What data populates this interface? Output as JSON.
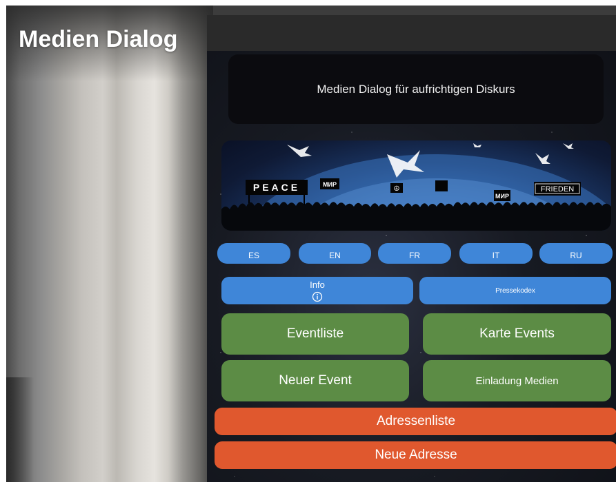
{
  "app": {
    "title": "Medien Dialog"
  },
  "intro": {
    "text": "Medien Dialog für aufrichtigen Diskurs"
  },
  "banner": {
    "signs": [
      "PEACE",
      "МИР",
      "МИР",
      "FRIEDEN"
    ],
    "colors": {
      "sky": "#1a3563",
      "earth": "#4d86c9"
    }
  },
  "languages": [
    "ES",
    "EN",
    "FR",
    "IT",
    "RU"
  ],
  "info_button": {
    "label": "Info",
    "icon": "info-circle-icon"
  },
  "presse_button": {
    "label": "Pressekodex"
  },
  "actions": {
    "eventliste": "Eventliste",
    "karte_events": "Karte Events",
    "neuer_event": "Neuer Event",
    "einladung_medien": "Einladung Medien",
    "adressenliste": "Adressenliste",
    "neue_adresse": "Neue Adresse"
  },
  "colors": {
    "blue": "#3f86d8",
    "green": "#5c8c45",
    "orange": "#e0582e",
    "header": "#2a2a2a"
  }
}
